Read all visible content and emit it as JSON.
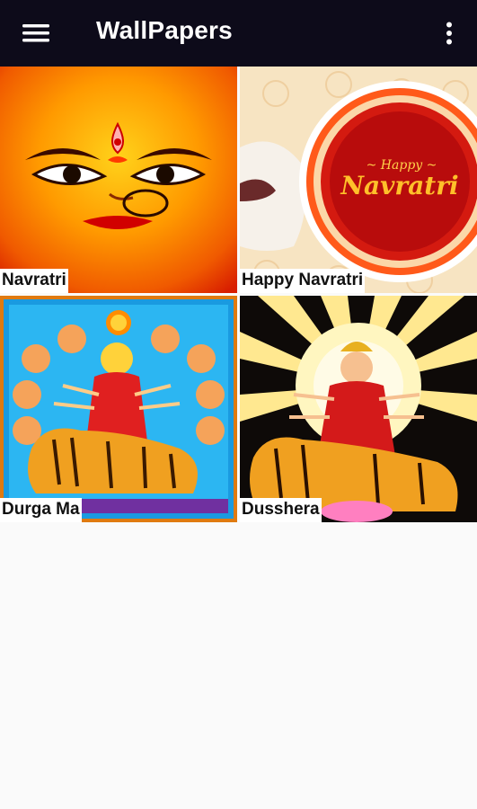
{
  "app_bar": {
    "title": "WallPapers",
    "menu_icon": "hamburger-menu-icon",
    "overflow_icon": "more-vert-icon",
    "background": "#0d0b1a"
  },
  "wallpapers": [
    {
      "label": "Navratri"
    },
    {
      "label": "Happy Navratri",
      "image_text_top": "~ Happy ~",
      "image_text_main": "Navratri"
    },
    {
      "label": "Durga Ma"
    },
    {
      "label": "Dusshera"
    }
  ]
}
